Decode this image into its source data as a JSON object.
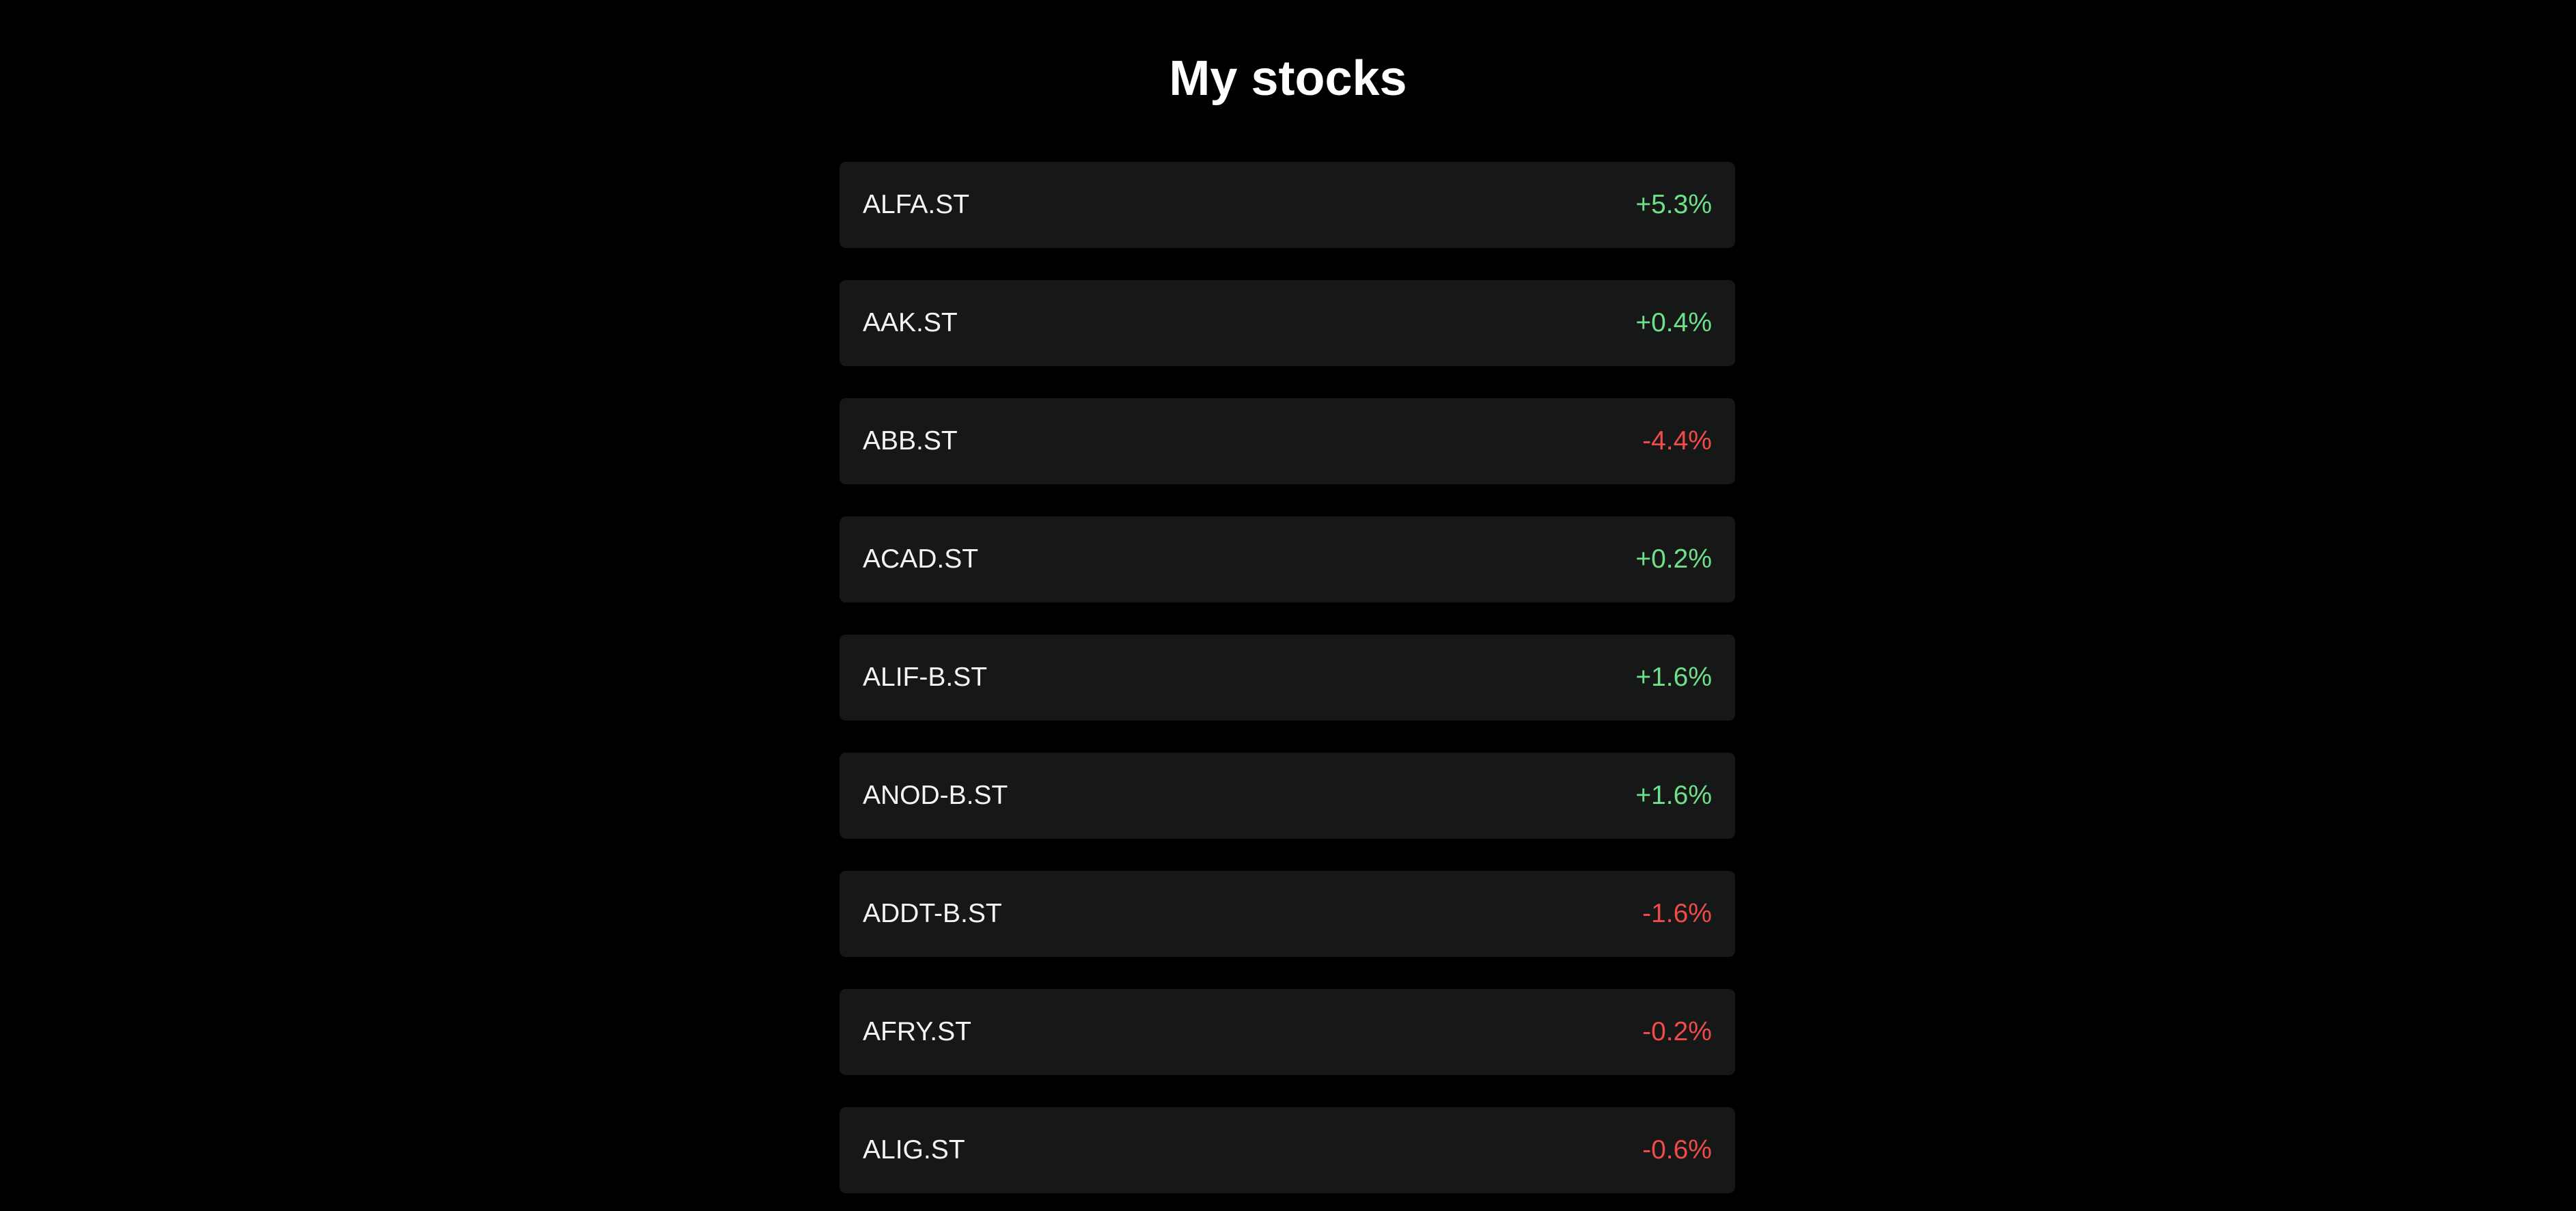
{
  "page": {
    "title": "My stocks"
  },
  "colors": {
    "background": "#000000",
    "row_background": "#161818",
    "positive": "#6fe08a",
    "negative": "#f04a4a"
  },
  "stocks": [
    {
      "ticker": "ALFA.ST",
      "change": "+5.3%",
      "direction": "up"
    },
    {
      "ticker": "AAK.ST",
      "change": "+0.4%",
      "direction": "up"
    },
    {
      "ticker": "ABB.ST",
      "change": "-4.4%",
      "direction": "down"
    },
    {
      "ticker": "ACAD.ST",
      "change": "+0.2%",
      "direction": "up"
    },
    {
      "ticker": "ALIF-B.ST",
      "change": "+1.6%",
      "direction": "up"
    },
    {
      "ticker": "ANOD-B.ST",
      "change": "+1.6%",
      "direction": "up"
    },
    {
      "ticker": "ADDT-B.ST",
      "change": "-1.6%",
      "direction": "down"
    },
    {
      "ticker": "AFRY.ST",
      "change": "-0.2%",
      "direction": "down"
    },
    {
      "ticker": "ALIG.ST",
      "change": "-0.6%",
      "direction": "down"
    }
  ]
}
